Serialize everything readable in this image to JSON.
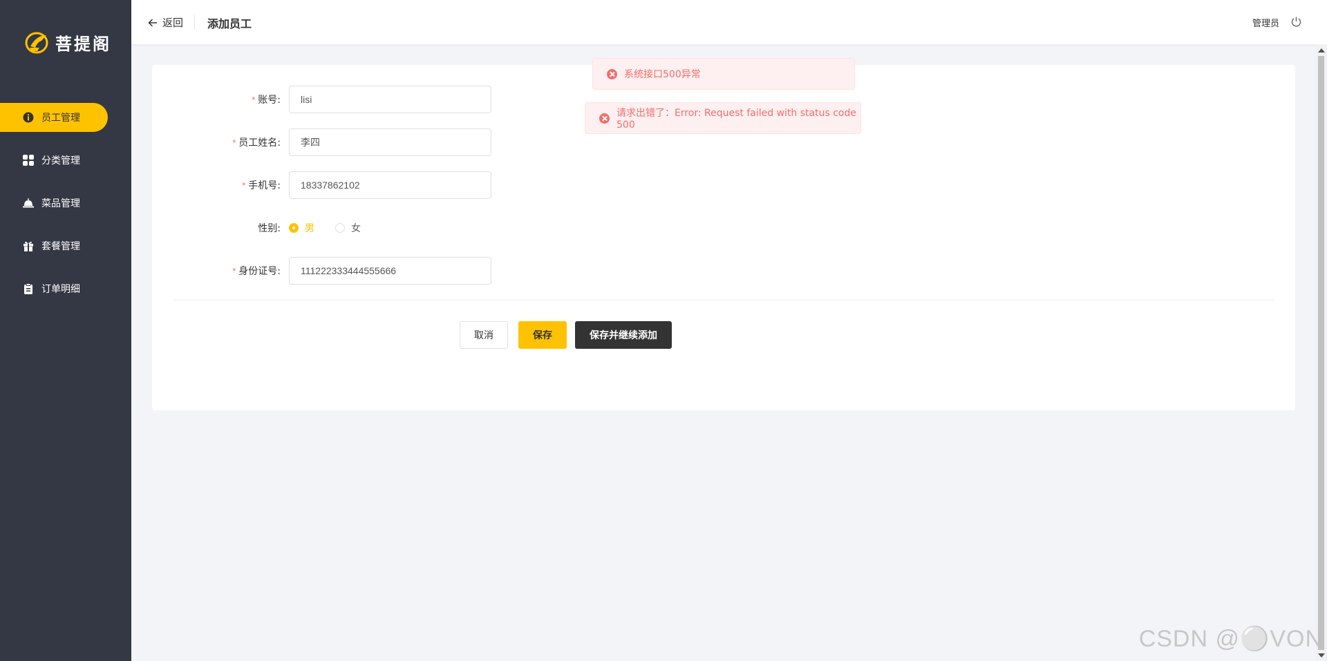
{
  "sidebar": {
    "logo_text": "菩提阁",
    "items": [
      {
        "label": "员工管理",
        "icon": "info-icon",
        "active": true
      },
      {
        "label": "分类管理",
        "icon": "grid-icon",
        "active": false
      },
      {
        "label": "菜品管理",
        "icon": "dish-icon",
        "active": false
      },
      {
        "label": "套餐管理",
        "icon": "gift-icon",
        "active": false
      },
      {
        "label": "订单明细",
        "icon": "clipboard-icon",
        "active": false
      }
    ]
  },
  "header": {
    "back_label": "返回",
    "title": "添加员工",
    "user": "管理员"
  },
  "form": {
    "account": {
      "label": "账号:",
      "value": "lisi",
      "required": true
    },
    "name": {
      "label": "员工姓名:",
      "value": "李四",
      "required": true
    },
    "phone": {
      "label": "手机号:",
      "value": "18337862102",
      "required": true
    },
    "gender": {
      "label": "性别:",
      "options": [
        "男",
        "女"
      ],
      "selected": "男"
    },
    "id_number": {
      "label": "身份证号:",
      "value": "111222333444555666",
      "required": true
    }
  },
  "buttons": {
    "cancel": "取消",
    "save": "保存",
    "save_continue": "保存并继续添加"
  },
  "toasts": [
    {
      "message": "系统接口500异常"
    },
    {
      "message": "请求出错了：Error: Request failed with status code 500"
    }
  ],
  "watermark": "CSDN @⚪VON",
  "colors": {
    "sidebar_bg": "#343744",
    "accent": "#ffc200",
    "error": "#f56c6c",
    "dark_button": "#333333"
  }
}
